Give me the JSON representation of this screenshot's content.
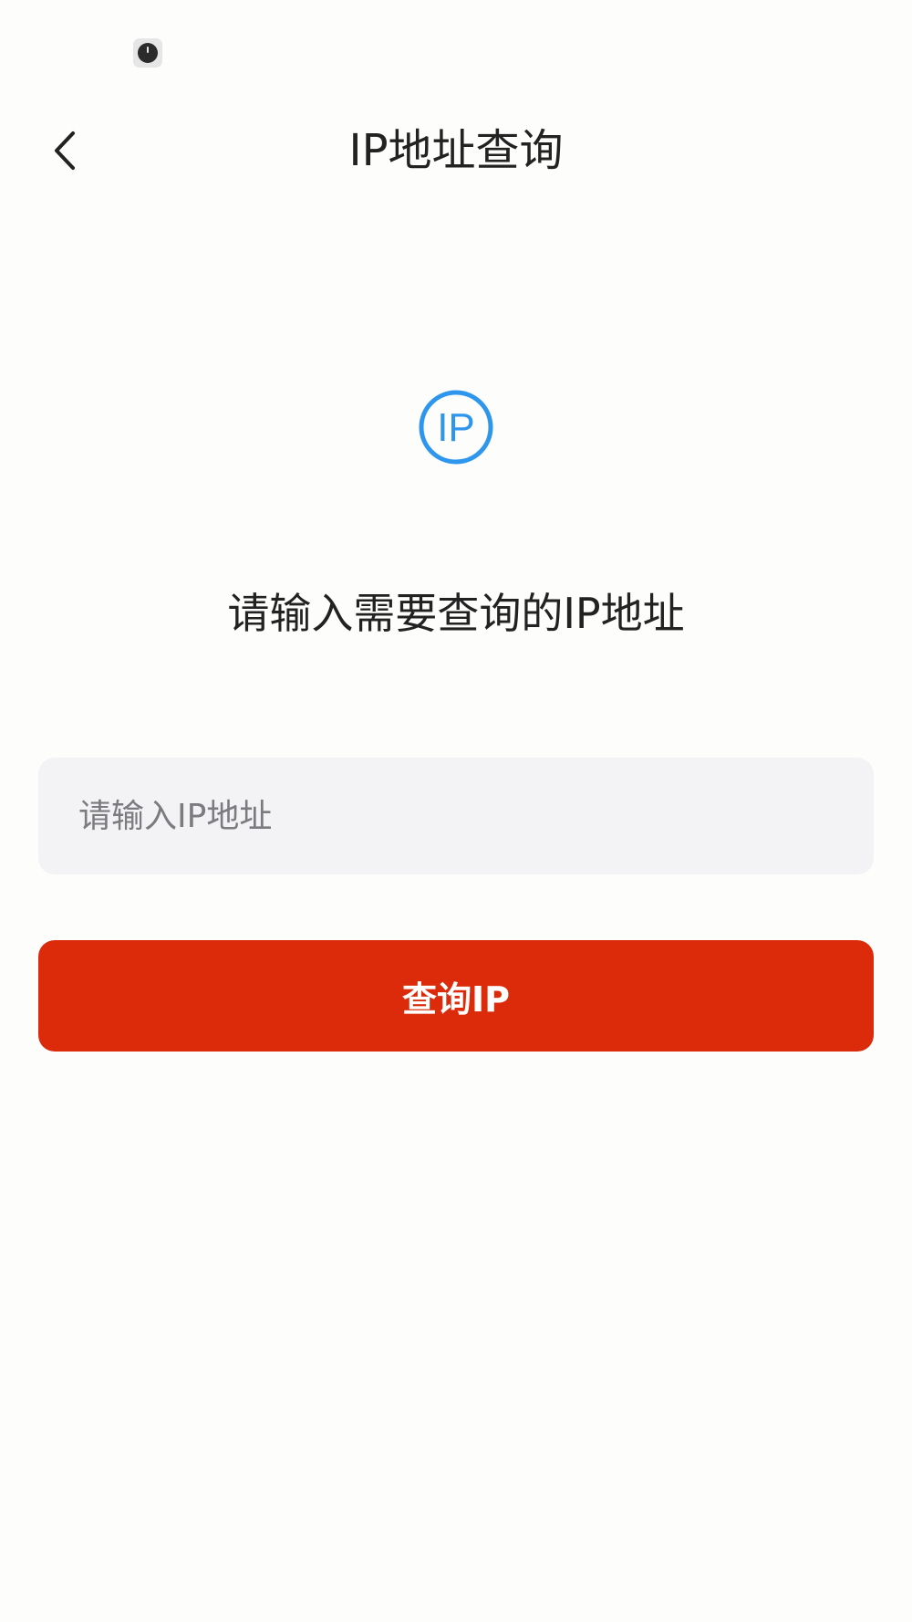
{
  "status_bar": {
    "icon": "notification-dot-icon"
  },
  "header": {
    "title": "IP地址查询",
    "back_icon": "chevron-left-icon"
  },
  "logo": {
    "icon": "ip-circle-icon",
    "text": "IP",
    "color": "#2f96ee"
  },
  "main": {
    "prompt": "请输入需要查询的IP地址",
    "input": {
      "value": "",
      "placeholder": "请输入IP地址"
    },
    "query_button": {
      "label": "查询IP",
      "color": "#db2b0a"
    }
  }
}
